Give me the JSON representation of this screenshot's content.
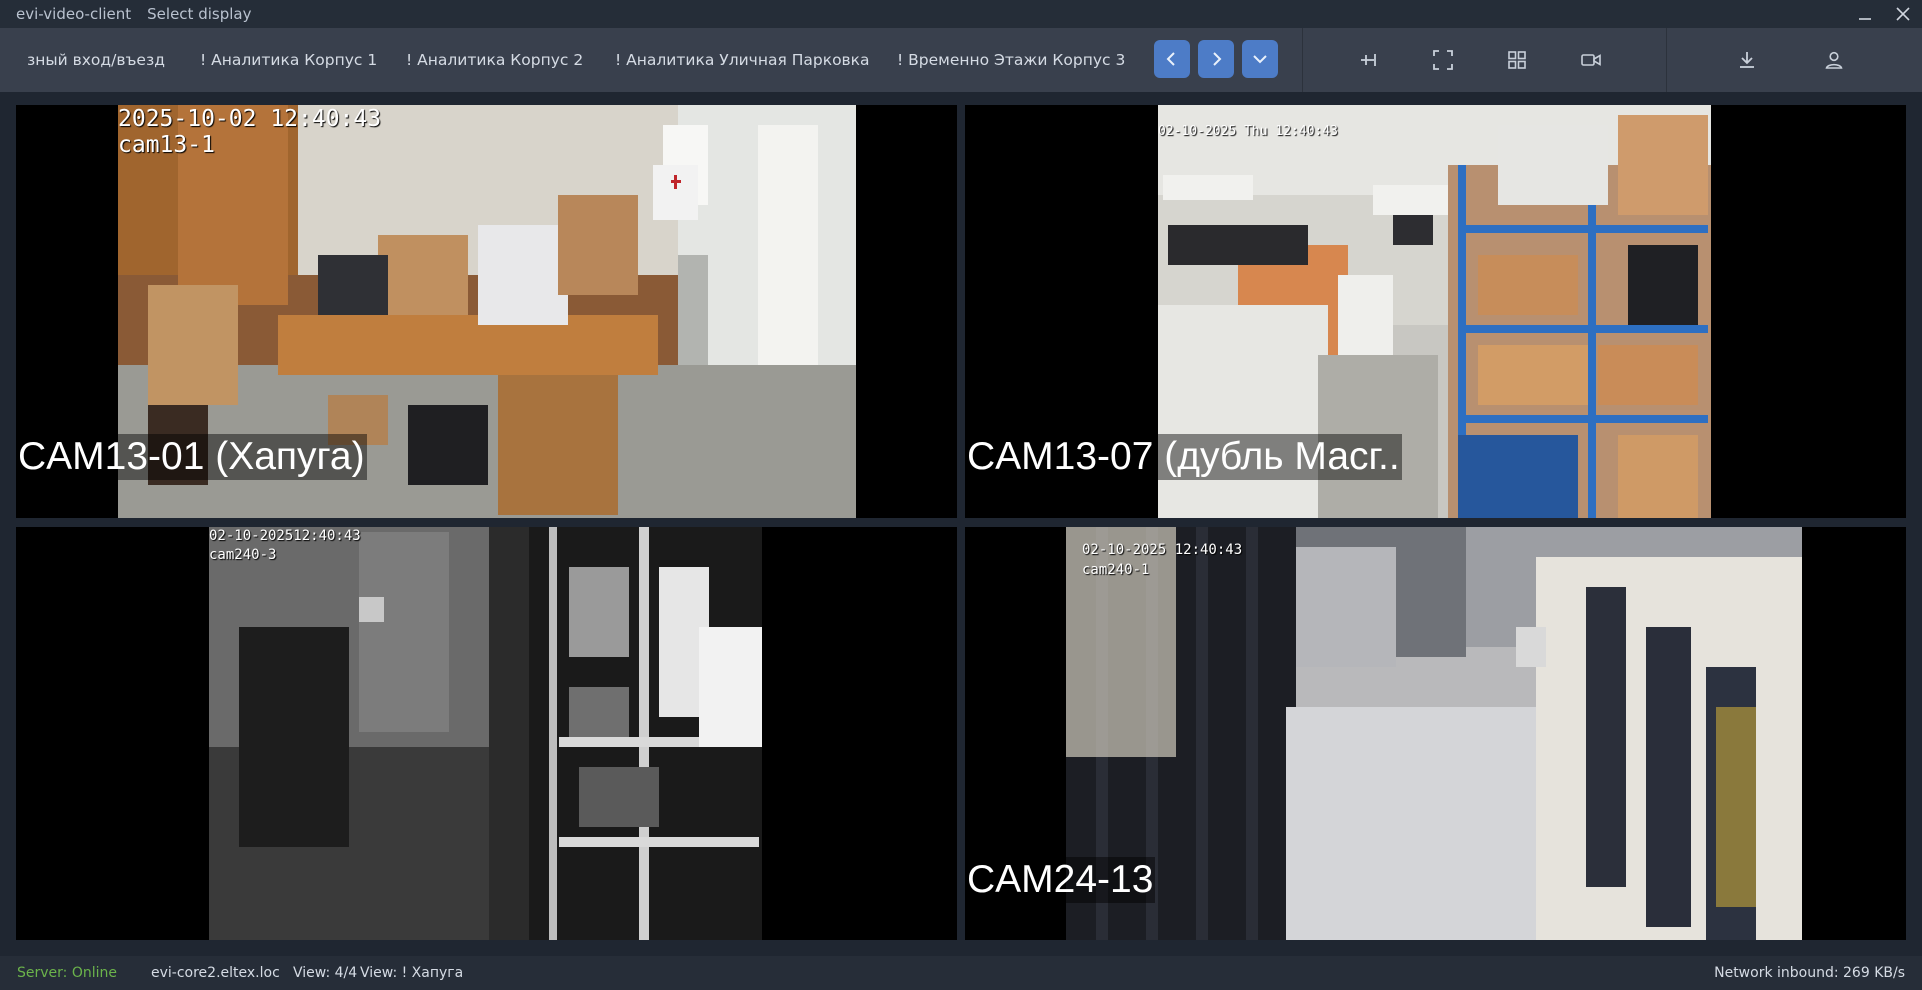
{
  "window": {
    "app_title": "evi-video-client",
    "menu_select_display": "Select display",
    "minimize_glyph": "—",
    "close_glyph": "✕"
  },
  "toolbar": {
    "tabs": [
      {
        "label": "зный вход/въезд"
      },
      {
        "label": "! Аналитика Корпус 1"
      },
      {
        "label": "! Аналитика Корпус 2"
      },
      {
        "label": "! Аналитика Уличная Парковка"
      },
      {
        "label": "! Временно Этажи Корпус 3"
      }
    ],
    "nav_icons": [
      "chevron-left-icon",
      "chevron-right-icon",
      "chevron-down-icon"
    ],
    "tool_icons": [
      "pin-icon",
      "fullscreen-icon",
      "grid-layout-icon",
      "camera-icon",
      "download-icon",
      "user-icon"
    ],
    "accent_color": "#4d7cc7"
  },
  "cameras": [
    {
      "label": "CAM13-01 (Хапуга)",
      "osd_time": "2025-10-02 12:40:43",
      "osd_name": "cam13-1",
      "scene": "office-storage"
    },
    {
      "label": "CAM13-07 (дубль Масг..",
      "osd_time": "02-10-2025 Thu 12:40:43",
      "osd_name": "",
      "scene": "warehouse-shelves"
    },
    {
      "label": "",
      "osd_time": "02-10-202512:40:43",
      "osd_name": "cam240-3",
      "scene": "server-room-night"
    },
    {
      "label": "CAM24-13",
      "osd_time": "02-10-2025 12:40:43",
      "osd_name": "cam240-1",
      "scene": "server-room-racks"
    }
  ],
  "status": {
    "server": "Server: Online",
    "host": "evi-core2.eltex.loc",
    "view_count": "View: 4/4",
    "view_name": "View: ! Хапуга",
    "network": "Network inbound: 269 KB/s",
    "online_color": "#6bb34b"
  }
}
